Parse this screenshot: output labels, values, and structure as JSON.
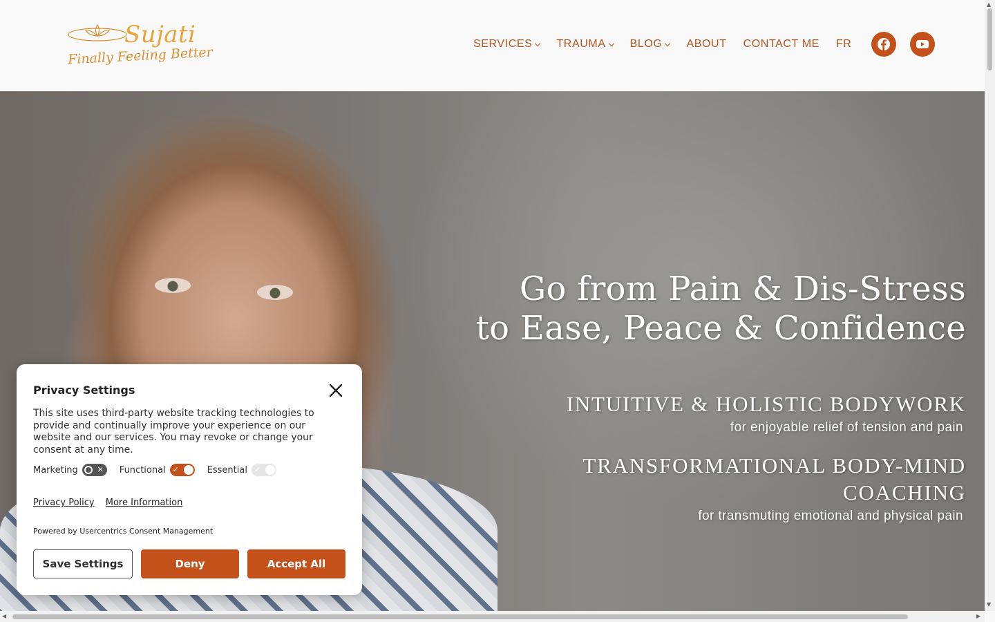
{
  "logo": {
    "name": "Sujati",
    "tagline": "Finally Feeling Better"
  },
  "nav": {
    "items": [
      {
        "label": "SERVICES",
        "dropdown": true
      },
      {
        "label": "TRAUMA",
        "dropdown": true
      },
      {
        "label": "BLOG",
        "dropdown": true
      },
      {
        "label": "ABOUT",
        "dropdown": false
      },
      {
        "label": "CONTACT ME",
        "dropdown": false
      },
      {
        "label": "FR",
        "dropdown": false
      }
    ],
    "social": [
      {
        "icon": "facebook-icon"
      },
      {
        "icon": "youtube-icon"
      }
    ]
  },
  "hero": {
    "headline_line1": "Go from Pain & Dis-Stress",
    "headline_line2": "to Ease, Peace & Confidence",
    "service1_title": "INTUITIVE & HOLISTIC BODYWORK",
    "service1_sub": "for enjoyable relief of tension and pain",
    "service2_title_line1": "TRANSFORMATIONAL BODY-MIND",
    "service2_title_line2": "COACHING",
    "service2_sub": "for transmuting emotional and physical pain"
  },
  "privacy": {
    "title": "Privacy Settings",
    "text": "This site uses third-party website tracking technologies to provide and continually improve your experience on our website and our services. You may revoke or change your consent at any time.",
    "toggles": [
      {
        "label": "Marketing",
        "state": "off"
      },
      {
        "label": "Functional",
        "state": "on"
      },
      {
        "label": "Essential",
        "state": "disabled-on"
      }
    ],
    "privacy_policy_link": "Privacy Policy",
    "more_info_link": "More Information",
    "powered_by": "Powered by Usercentrics Consent Management",
    "save_label": "Save Settings",
    "deny_label": "Deny",
    "accept_label": "Accept All"
  },
  "colors": {
    "accent": "#c4501a",
    "nav_text": "#b5541c",
    "logo": "#e8a33a"
  }
}
